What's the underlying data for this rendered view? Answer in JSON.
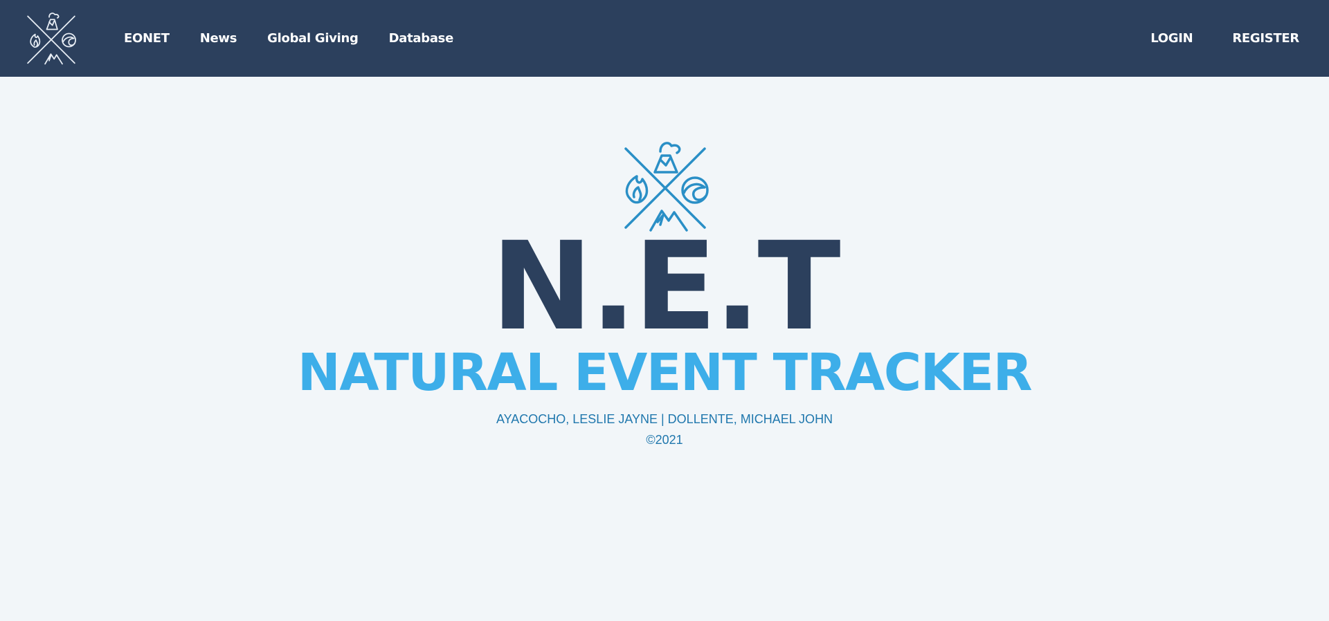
{
  "colors": {
    "navbar_bg": "#2c405d",
    "page_bg": "#f2f6f9",
    "nav_text": "#ffffff",
    "abbr": "#2c405d",
    "title": "#3daee9",
    "credits": "#1f77ad"
  },
  "navbar": {
    "logo_icon": "crossed-lines-volcano-fire-wave-mountain-icon",
    "links": [
      "EONET",
      "News",
      "Global Giving",
      "Database"
    ],
    "login_label": "LOGIN",
    "register_label": "REGISTER"
  },
  "hero": {
    "emblem_icon": "crossed-lines-volcano-fire-wave-mountain-icon",
    "abbreviation": "N.E.T",
    "title": "NATURAL EVENT TRACKER",
    "authors": "AYACOCHO, LESLIE JAYNE | DOLLENTE, MICHAEL JOHN",
    "copyright": "©2021"
  }
}
